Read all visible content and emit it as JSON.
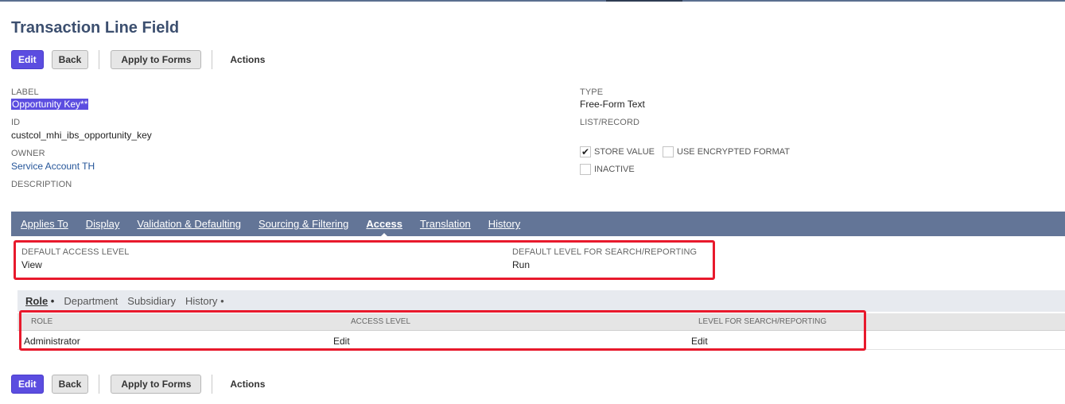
{
  "page": {
    "title": "Transaction Line Field"
  },
  "toolbar": {
    "edit_label": "Edit",
    "back_label": "Back",
    "apply_label": "Apply to Forms",
    "actions_label": "Actions"
  },
  "fields": {
    "label": {
      "label": "LABEL",
      "value": "Opportunity Key**"
    },
    "id": {
      "label": "ID",
      "value": "custcol_mhi_ibs_opportunity_key"
    },
    "owner": {
      "label": "OWNER",
      "value": "Service Account TH"
    },
    "description": {
      "label": "DESCRIPTION"
    },
    "type": {
      "label": "TYPE",
      "value": "Free-Form Text"
    },
    "list_record": {
      "label": "LIST/RECORD"
    },
    "store_value": {
      "label": "STORE VALUE",
      "checked": true
    },
    "encrypted": {
      "label": "USE ENCRYPTED FORMAT",
      "checked": false
    },
    "inactive": {
      "label": "INACTIVE",
      "checked": false
    }
  },
  "tabs": [
    {
      "label": "Applies To",
      "active": false
    },
    {
      "label": "Display",
      "active": false
    },
    {
      "label": "Validation & Defaulting",
      "active": false
    },
    {
      "label": "Sourcing & Filtering",
      "active": false
    },
    {
      "label": "Access",
      "active": true
    },
    {
      "label": "Translation",
      "active": false
    },
    {
      "label": "History",
      "active": false
    }
  ],
  "access": {
    "default_access": {
      "label": "DEFAULT ACCESS LEVEL",
      "value": "View"
    },
    "default_search": {
      "label": "DEFAULT LEVEL FOR SEARCH/REPORTING",
      "value": "Run"
    }
  },
  "subtabs": [
    {
      "label": "Role",
      "bullet": "•",
      "active": true
    },
    {
      "label": "Department",
      "bullet": "",
      "active": false
    },
    {
      "label": "Subsidiary",
      "bullet": "",
      "active": false
    },
    {
      "label": "History",
      "bullet": "•",
      "active": false
    }
  ],
  "grid": {
    "columns": [
      "ROLE",
      "ACCESS LEVEL",
      "LEVEL FOR SEARCH/REPORTING"
    ],
    "rows": [
      {
        "role": "Administrator",
        "access_level": "Edit",
        "search_level": "Edit"
      }
    ]
  },
  "colors": {
    "primary": "#5b4de0",
    "tabbar": "#637597",
    "title": "#3c4f6f",
    "annotation": "#e8192c",
    "link": "#255599"
  },
  "icons": {
    "checkbox_checked": "check-icon"
  }
}
